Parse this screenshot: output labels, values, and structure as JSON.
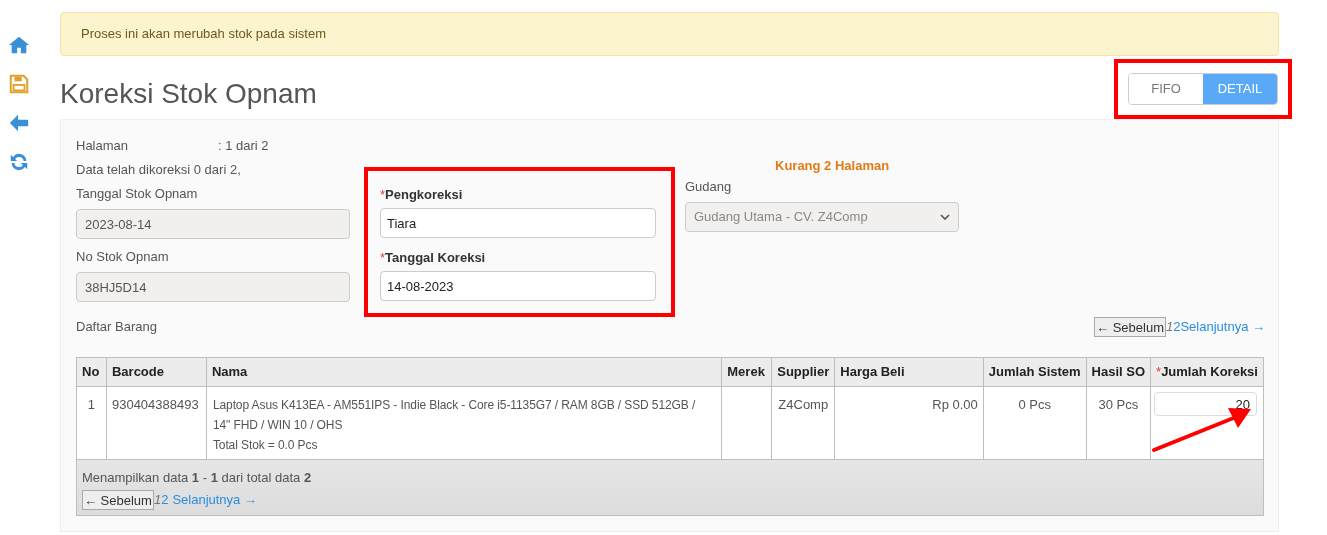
{
  "sidebar": {
    "items": [
      {
        "kind": "home"
      },
      {
        "kind": "save"
      },
      {
        "kind": "back"
      },
      {
        "kind": "refresh"
      }
    ]
  },
  "alert": "Proses ini akan merubah stok pada sistem",
  "title": "Koreksi Stok Opnam",
  "view_toggle": [
    {
      "label": "FIFO",
      "selected": false
    },
    {
      "label": "DETAIL",
      "selected": true
    }
  ],
  "info": {
    "page_label": "Halaman",
    "page_value": ": 1 dari 2",
    "corrected": "Data telah dikoreksi 0 dari 2,",
    "remaining": "Kurang 2 Halaman"
  },
  "left_fields": [
    {
      "label": "Tanggal Stok Opnam",
      "value": "2023-08-14",
      "disabled": true
    },
    {
      "label": "No Stok Opnam",
      "value": "38HJ5D14",
      "disabled": true
    }
  ],
  "correction_fields": [
    {
      "mark": "*",
      "label": "Pengkoreksi",
      "value": "Tiara"
    },
    {
      "mark": "*",
      "label": "Tanggal Koreksi",
      "value": "14-08-2023"
    }
  ],
  "warehouse": {
    "label": "Gudang",
    "value": "Gudang Utama - CV. Z4Comp",
    "disabled": true
  },
  "list_label": "Daftar Barang",
  "pager_top": {
    "prev": "← Sebelum",
    "pages": [
      {
        "label": "1",
        "selected": true
      },
      {
        "label": "2",
        "selected": false
      }
    ],
    "next": "Selanjutnya →"
  },
  "table": {
    "columns": [
      {
        "label": "No"
      },
      {
        "label": "Barcode"
      },
      {
        "label": "Nama"
      },
      {
        "label": "Merek"
      },
      {
        "label": "Supplier"
      },
      {
        "label": "Harga Beli"
      },
      {
        "label": "Jumlah Sistem"
      },
      {
        "label": "Hasil SO"
      },
      {
        "label": "Jumlah Koreksi",
        "mark": "*"
      }
    ],
    "rows": [
      {
        "no": "1",
        "barcode": "930404388493",
        "name": "Laptop Asus K413EA - AM551IPS - Indie Black - Core i5-1135G7 / RAM 8GB / SSD 512GB / 14\" FHD / WIN 10 / OHS",
        "total_stock": "Total Stok = 0.0 Pcs",
        "brand": "",
        "supplier": "Z4Comp",
        "price": "Rp 0.00",
        "system_qty": "0 Pcs",
        "so_result": "30 Pcs",
        "correction": "20"
      }
    ],
    "footer": "Menampilkan data **1** - **1** dari total data **2**",
    "pager": {
      "prev": "← Sebelum",
      "pages": [
        {
          "label": "1",
          "selected": true
        },
        {
          "label": "2",
          "selected": false
        }
      ],
      "next": "Selanjutnya →"
    }
  }
}
